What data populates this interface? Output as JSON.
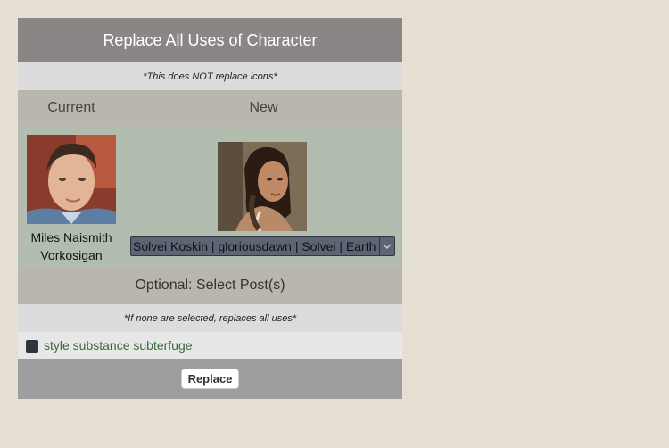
{
  "dialog": {
    "title": "Replace All Uses of Character",
    "icons_note": "*This does NOT replace icons*"
  },
  "columns": {
    "current_label": "Current",
    "new_label": "New"
  },
  "current_character": {
    "name": "Miles Naismith Vorkosigan",
    "avatar": "man-portrait-avatar"
  },
  "new_character": {
    "avatar": "woman-portrait-avatar",
    "selected": "Solvei Koskin | gloriousdawn | Solvei | Earth"
  },
  "posts": {
    "header": "Optional: Select Post(s)",
    "note": "*If none are selected, replaces all uses*",
    "items": [
      {
        "label": "style substance subterfuge",
        "checked": false
      }
    ]
  },
  "actions": {
    "replace_label": "Replace"
  },
  "colors": {
    "page_bg": "#e6e0d4",
    "title_bar": "#8a8686",
    "character_row": "#b3bdaf",
    "post_link": "#3a6a3a"
  }
}
